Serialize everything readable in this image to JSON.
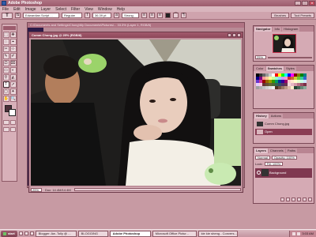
{
  "window": {
    "title": "Adobe Photoshop",
    "buttons": [
      "_",
      "□",
      "×"
    ]
  },
  "menu": [
    "File",
    "Edit",
    "Image",
    "Layer",
    "Select",
    "Filter",
    "View",
    "Window",
    "Help"
  ],
  "options": {
    "tool_preset": "T",
    "font_family": "Edwardian Script ...",
    "font_style": "Regular",
    "font_size": "36.39 pt",
    "aa": "Strong",
    "palette_well": [
      "Brushes",
      "Tool Presets"
    ]
  },
  "outer_document": {
    "title": "C:\\Documents and Settings\\Chong\\My Documents\\Pictures\\... 33.3% (Layer 1, RGB/8)"
  },
  "document": {
    "title": "Comm Chong.jpg @ 25% (RGB/8)",
    "zoom": "25%",
    "doc_info": "Doc: 14.4M/14.4M"
  },
  "outer_status": {
    "zoom": "33.33%"
  },
  "navigator": {
    "tabs": [
      "Navigator",
      "Info",
      "Histogram"
    ],
    "zoom": "25%"
  },
  "color": {
    "tabs": [
      "Color",
      "Swatches",
      "Styles"
    ],
    "swatches": [
      "#000000",
      "#333333",
      "#666666",
      "#999999",
      "#cccccc",
      "#ffffff",
      "#ff0000",
      "#ffff00",
      "#00ff00",
      "#00ffff",
      "#0000ff",
      "#ff00ff",
      "#800000",
      "#808000",
      "#008000",
      "#008080",
      "#000080",
      "#800080",
      "#ff9999",
      "#ffcc99",
      "#ffff99",
      "#ccff99",
      "#99ffcc",
      "#99ccff",
      "#cc99ff",
      "#ff99cc",
      "#cc3333",
      "#cc6633",
      "#cccc33",
      "#66cc33",
      "#33cc99",
      "#3366cc",
      "#6633cc",
      "#cc3399",
      "#990000",
      "#996600",
      "#999900",
      "#339900",
      "#009966",
      "#003399",
      "#330099",
      "#990066",
      "#ffcccc",
      "#ffe5cc",
      "#ffffcc",
      "#e5ffcc",
      "#ccffe5",
      "#cce5ff",
      "#e5ccff",
      "#ffcce5",
      "#663333",
      "#664d33",
      "#666633",
      "#4d6633",
      "#33664d",
      "#334d66",
      "#4d3366",
      "#663350",
      "#f2d9df",
      "#e6b8c4",
      "#d499a8",
      "#b86e83",
      "#994d63",
      "#7a2e45",
      "#a0a0a0",
      "#b0b0b0",
      "#c0c0c0",
      "#d0d0d0",
      "#e0e0e0",
      "#f0f0f0",
      "#553322",
      "#775544",
      "#997766",
      "#bb9988",
      "#ddbbaa",
      "#ffeecc",
      "#224433",
      "#446655",
      "#668877",
      "#88aa99"
    ]
  },
  "history": {
    "tabs": [
      "History",
      "Actions"
    ],
    "items": [
      "Comm Chong.jpg",
      "Open"
    ]
  },
  "layers": {
    "tabs": [
      "Layers",
      "Channels",
      "Paths"
    ],
    "blend": "Normal",
    "opacity": "Opacity: 100%",
    "fill": "Fill: 100%",
    "lock": "Lock:",
    "layer_name": "Background"
  },
  "taskbar": {
    "start": "start",
    "tasks": [
      "Blogger: Aw..Tolly @ ...",
      "BLOGGING",
      "Adobe Photoshop",
      "Microsoft Office Pictur...",
      "kie kie sheng - Convers..."
    ],
    "active_index": 2,
    "clock": "3:03 AM"
  },
  "tools": [
    "⬚",
    "✥",
    "◌",
    "⌖",
    "✂",
    "⊹",
    "✎",
    "✐",
    "⎚",
    "⌧",
    "▭",
    "◐",
    "⚲",
    "◭",
    "T",
    "➚",
    "▢",
    "✦",
    "✋",
    "🔍"
  ]
}
